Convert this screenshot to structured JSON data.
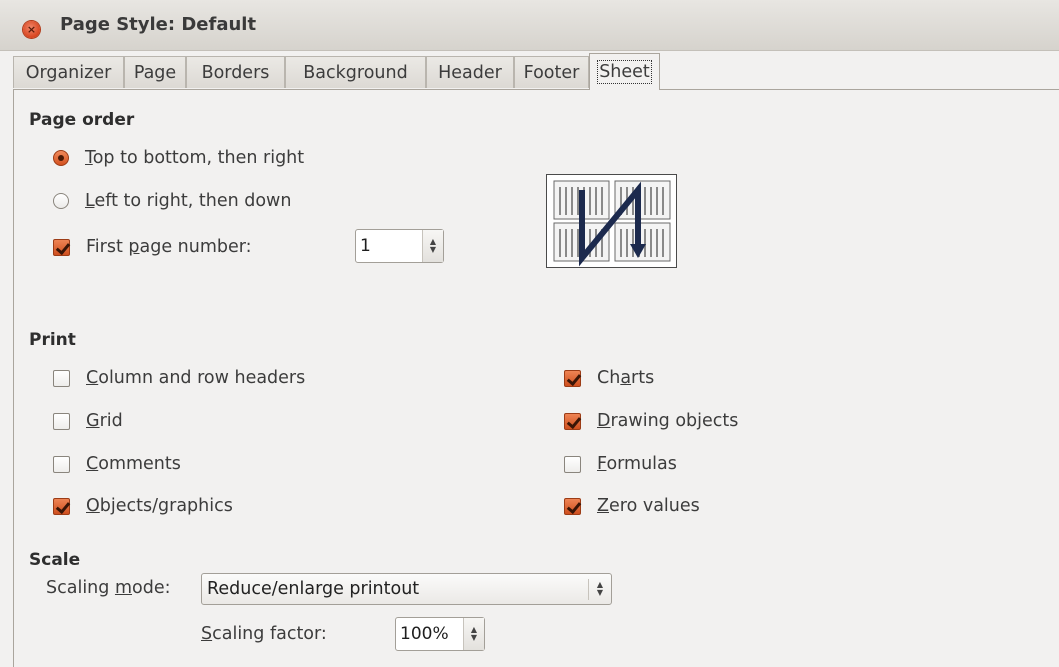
{
  "window": {
    "title": "Page Style: Default"
  },
  "tabs": [
    {
      "label": "Organizer"
    },
    {
      "label": "Page"
    },
    {
      "label": "Borders"
    },
    {
      "label": "Background"
    },
    {
      "label": "Header"
    },
    {
      "label": "Footer"
    },
    {
      "label": "Sheet",
      "active": true
    }
  ],
  "page_order": {
    "title": "Page order",
    "top_to_bottom": {
      "label_mn": "T",
      "label_rest": "op to bottom, then right",
      "selected": true
    },
    "left_to_right": {
      "label_mn": "L",
      "label_rest": "eft to right, then down",
      "selected": false
    },
    "first_page_number": {
      "label_pre": "First ",
      "label_mn": "p",
      "label_post": "age number:",
      "checked": true,
      "value": "1"
    }
  },
  "print": {
    "title": "Print",
    "column_row_headers": {
      "label_mn": "C",
      "label_rest": "olumn and row headers",
      "checked": false
    },
    "grid": {
      "label_mn": "G",
      "label_rest": "rid",
      "checked": false
    },
    "comments": {
      "label_mn": "C",
      "label_rest": "omments",
      "checked": false
    },
    "objects_graphics": {
      "label_mn": "O",
      "label_rest": "bjects/graphics",
      "checked": true
    },
    "charts": {
      "label_pre": "Ch",
      "label_mn": "a",
      "label_post": "rts",
      "checked": true
    },
    "drawing_objects": {
      "label_mn": "D",
      "label_rest": "rawing objects",
      "checked": true
    },
    "formulas": {
      "label_mn": "F",
      "label_rest": "ormulas",
      "checked": false
    },
    "zero_values": {
      "label_mn": "Z",
      "label_rest": "ero values",
      "checked": true
    }
  },
  "scale": {
    "title": "Scale",
    "mode_label_pre": "Scaling ",
    "mode_label_mn": "m",
    "mode_label_post": "ode:",
    "mode_value": "Reduce/enlarge printout",
    "factor_label_mn": "S",
    "factor_label_rest": "caling factor:",
    "factor_value": "100%"
  },
  "colors": {
    "accent": "#d4511f",
    "background": "#f2f1f0",
    "preview_arrow": "#1c2a4e"
  },
  "icons": [
    "close-icon",
    "page-order-preview-icon",
    "spin-up-icon",
    "spin-down-icon"
  ]
}
